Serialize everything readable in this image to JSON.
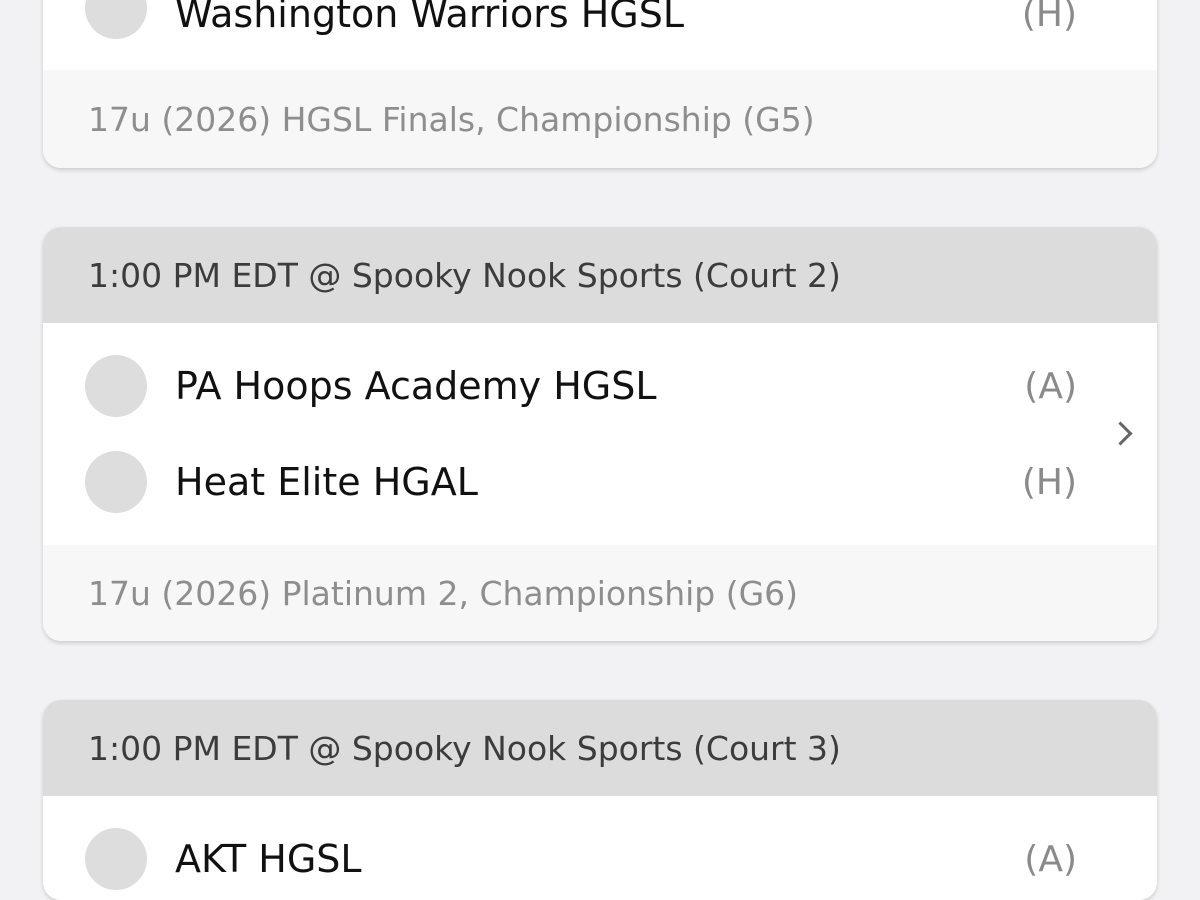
{
  "games": [
    {
      "header": "",
      "teams": [
        {
          "name": "Washington Warriors HGSL",
          "side": "(H)"
        }
      ],
      "division": "17u (2026) HGSL Finals, Championship (G5)"
    },
    {
      "header": "1:00 PM EDT @ Spooky Nook Sports (Court 2)",
      "teams": [
        {
          "name": "PA Hoops Academy HGSL",
          "side": "(A)"
        },
        {
          "name": "Heat Elite HGAL",
          "side": "(H)"
        }
      ],
      "division": "17u (2026) Platinum 2, Championship (G6)"
    },
    {
      "header": "1:00 PM EDT @ Spooky Nook Sports (Court 3)",
      "teams": [
        {
          "name": "AKT HGSL",
          "side": "(A)"
        }
      ],
      "division": ""
    }
  ],
  "icons": {
    "avatar": "team-avatar-placeholder",
    "chevron": "chevron-right-icon"
  }
}
